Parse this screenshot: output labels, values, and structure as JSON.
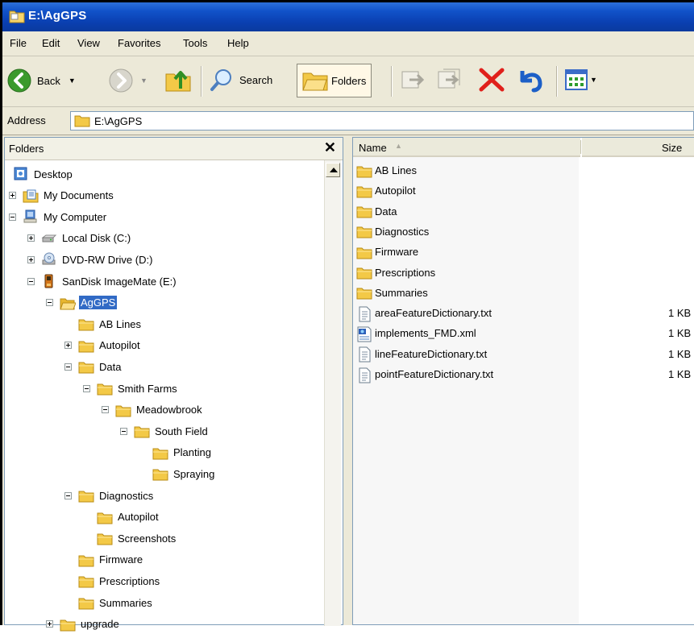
{
  "window": {
    "title": "E:\\AgGPS"
  },
  "menu": [
    {
      "label": "File"
    },
    {
      "label": "Edit"
    },
    {
      "label": "View"
    },
    {
      "label": "Favorites"
    },
    {
      "label": "Tools"
    },
    {
      "label": "Help"
    }
  ],
  "toolbar": {
    "back_label": "Back",
    "search_label": "Search",
    "folders_label": "Folders"
  },
  "address": {
    "label": "Address",
    "value": "E:\\AgGPS"
  },
  "folders_pane": {
    "title": "Folders",
    "close_glyph": "✕",
    "tree": [
      {
        "label": "Desktop",
        "icon": "desktop-icon",
        "depth": 0,
        "expander": "none"
      },
      {
        "label": "My Documents",
        "icon": "my-documents-icon",
        "depth": 1,
        "expander": "plus"
      },
      {
        "label": "My Computer",
        "icon": "my-computer-icon",
        "depth": 1,
        "expander": "minus"
      },
      {
        "label": "Local Disk (C:)",
        "icon": "hard-drive-icon",
        "depth": 2,
        "expander": "plus"
      },
      {
        "label": "DVD-RW Drive (D:)",
        "icon": "dvd-drive-icon",
        "depth": 2,
        "expander": "plus"
      },
      {
        "label": "SanDisk ImageMate (E:)",
        "icon": "removable-drive-icon",
        "depth": 2,
        "expander": "minus"
      },
      {
        "label": "AgGPS",
        "icon": "folder-open-icon",
        "depth": 3,
        "expander": "minus",
        "selected": true
      },
      {
        "label": "AB Lines",
        "icon": "folder-icon",
        "depth": 4,
        "expander": "none"
      },
      {
        "label": "Autopilot",
        "icon": "folder-icon",
        "depth": 4,
        "expander": "plus"
      },
      {
        "label": "Data",
        "icon": "folder-icon",
        "depth": 4,
        "expander": "minus"
      },
      {
        "label": "Smith Farms",
        "icon": "folder-icon",
        "depth": 5,
        "expander": "minus"
      },
      {
        "label": "Meadowbrook",
        "icon": "folder-icon",
        "depth": 6,
        "expander": "minus"
      },
      {
        "label": "South Field",
        "icon": "folder-icon",
        "depth": 7,
        "expander": "minus"
      },
      {
        "label": "Planting",
        "icon": "folder-icon",
        "depth": 8,
        "expander": "none"
      },
      {
        "label": "Spraying",
        "icon": "folder-icon",
        "depth": 8,
        "expander": "none"
      },
      {
        "label": "Diagnostics",
        "icon": "folder-icon",
        "depth": 4,
        "expander": "minus"
      },
      {
        "label": "Autopilot",
        "icon": "folder-icon",
        "depth": 5,
        "expander": "none"
      },
      {
        "label": "Screenshots",
        "icon": "folder-icon",
        "depth": 5,
        "expander": "none"
      },
      {
        "label": "Firmware",
        "icon": "folder-icon",
        "depth": 4,
        "expander": "none"
      },
      {
        "label": "Prescriptions",
        "icon": "folder-icon",
        "depth": 4,
        "expander": "none"
      },
      {
        "label": "Summaries",
        "icon": "folder-icon",
        "depth": 4,
        "expander": "none"
      },
      {
        "label": "upgrade",
        "icon": "folder-icon",
        "depth": 3,
        "expander": "plus"
      }
    ]
  },
  "file_list": {
    "columns": [
      {
        "label": "Name"
      },
      {
        "label": "Size"
      }
    ],
    "sort_glyph": "▲",
    "rows": [
      {
        "name": "AB Lines",
        "size": "",
        "icon": "folder-icon"
      },
      {
        "name": "Autopilot",
        "size": "",
        "icon": "folder-icon"
      },
      {
        "name": "Data",
        "size": "",
        "icon": "folder-icon"
      },
      {
        "name": "Diagnostics",
        "size": "",
        "icon": "folder-icon"
      },
      {
        "name": "Firmware",
        "size": "",
        "icon": "folder-icon"
      },
      {
        "name": "Prescriptions",
        "size": "",
        "icon": "folder-icon"
      },
      {
        "name": "Summaries",
        "size": "",
        "icon": "folder-icon"
      },
      {
        "name": "areaFeatureDictionary.txt",
        "size": "1 KB",
        "icon": "text-file-icon"
      },
      {
        "name": "implements_FMD.xml",
        "size": "1 KB",
        "icon": "xml-file-icon"
      },
      {
        "name": "lineFeatureDictionary.txt",
        "size": "1 KB",
        "icon": "text-file-icon"
      },
      {
        "name": "pointFeatureDictionary.txt",
        "size": "1 KB",
        "icon": "text-file-icon"
      }
    ]
  }
}
